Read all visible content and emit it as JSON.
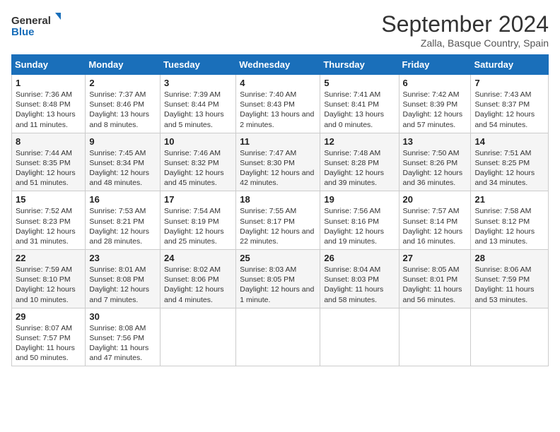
{
  "logo": {
    "line1": "General",
    "line2": "Blue"
  },
  "title": "September 2024",
  "subtitle": "Zalla, Basque Country, Spain",
  "weekdays": [
    "Sunday",
    "Monday",
    "Tuesday",
    "Wednesday",
    "Thursday",
    "Friday",
    "Saturday"
  ],
  "weeks": [
    [
      {
        "day": "1",
        "sunrise": "7:36 AM",
        "sunset": "8:48 PM",
        "daylight": "13 hours and 11 minutes."
      },
      {
        "day": "2",
        "sunrise": "7:37 AM",
        "sunset": "8:46 PM",
        "daylight": "13 hours and 8 minutes."
      },
      {
        "day": "3",
        "sunrise": "7:39 AM",
        "sunset": "8:44 PM",
        "daylight": "13 hours and 5 minutes."
      },
      {
        "day": "4",
        "sunrise": "7:40 AM",
        "sunset": "8:43 PM",
        "daylight": "13 hours and 2 minutes."
      },
      {
        "day": "5",
        "sunrise": "7:41 AM",
        "sunset": "8:41 PM",
        "daylight": "13 hours and 0 minutes."
      },
      {
        "day": "6",
        "sunrise": "7:42 AM",
        "sunset": "8:39 PM",
        "daylight": "12 hours and 57 minutes."
      },
      {
        "day": "7",
        "sunrise": "7:43 AM",
        "sunset": "8:37 PM",
        "daylight": "12 hours and 54 minutes."
      }
    ],
    [
      {
        "day": "8",
        "sunrise": "7:44 AM",
        "sunset": "8:35 PM",
        "daylight": "12 hours and 51 minutes."
      },
      {
        "day": "9",
        "sunrise": "7:45 AM",
        "sunset": "8:34 PM",
        "daylight": "12 hours and 48 minutes."
      },
      {
        "day": "10",
        "sunrise": "7:46 AM",
        "sunset": "8:32 PM",
        "daylight": "12 hours and 45 minutes."
      },
      {
        "day": "11",
        "sunrise": "7:47 AM",
        "sunset": "8:30 PM",
        "daylight": "12 hours and 42 minutes."
      },
      {
        "day": "12",
        "sunrise": "7:48 AM",
        "sunset": "8:28 PM",
        "daylight": "12 hours and 39 minutes."
      },
      {
        "day": "13",
        "sunrise": "7:50 AM",
        "sunset": "8:26 PM",
        "daylight": "12 hours and 36 minutes."
      },
      {
        "day": "14",
        "sunrise": "7:51 AM",
        "sunset": "8:25 PM",
        "daylight": "12 hours and 34 minutes."
      }
    ],
    [
      {
        "day": "15",
        "sunrise": "7:52 AM",
        "sunset": "8:23 PM",
        "daylight": "12 hours and 31 minutes."
      },
      {
        "day": "16",
        "sunrise": "7:53 AM",
        "sunset": "8:21 PM",
        "daylight": "12 hours and 28 minutes."
      },
      {
        "day": "17",
        "sunrise": "7:54 AM",
        "sunset": "8:19 PM",
        "daylight": "12 hours and 25 minutes."
      },
      {
        "day": "18",
        "sunrise": "7:55 AM",
        "sunset": "8:17 PM",
        "daylight": "12 hours and 22 minutes."
      },
      {
        "day": "19",
        "sunrise": "7:56 AM",
        "sunset": "8:16 PM",
        "daylight": "12 hours and 19 minutes."
      },
      {
        "day": "20",
        "sunrise": "7:57 AM",
        "sunset": "8:14 PM",
        "daylight": "12 hours and 16 minutes."
      },
      {
        "day": "21",
        "sunrise": "7:58 AM",
        "sunset": "8:12 PM",
        "daylight": "12 hours and 13 minutes."
      }
    ],
    [
      {
        "day": "22",
        "sunrise": "7:59 AM",
        "sunset": "8:10 PM",
        "daylight": "12 hours and 10 minutes."
      },
      {
        "day": "23",
        "sunrise": "8:01 AM",
        "sunset": "8:08 PM",
        "daylight": "12 hours and 7 minutes."
      },
      {
        "day": "24",
        "sunrise": "8:02 AM",
        "sunset": "8:06 PM",
        "daylight": "12 hours and 4 minutes."
      },
      {
        "day": "25",
        "sunrise": "8:03 AM",
        "sunset": "8:05 PM",
        "daylight": "12 hours and 1 minute."
      },
      {
        "day": "26",
        "sunrise": "8:04 AM",
        "sunset": "8:03 PM",
        "daylight": "11 hours and 58 minutes."
      },
      {
        "day": "27",
        "sunrise": "8:05 AM",
        "sunset": "8:01 PM",
        "daylight": "11 hours and 56 minutes."
      },
      {
        "day": "28",
        "sunrise": "8:06 AM",
        "sunset": "7:59 PM",
        "daylight": "11 hours and 53 minutes."
      }
    ],
    [
      {
        "day": "29",
        "sunrise": "8:07 AM",
        "sunset": "7:57 PM",
        "daylight": "11 hours and 50 minutes."
      },
      {
        "day": "30",
        "sunrise": "8:08 AM",
        "sunset": "7:56 PM",
        "daylight": "11 hours and 47 minutes."
      },
      null,
      null,
      null,
      null,
      null
    ]
  ]
}
